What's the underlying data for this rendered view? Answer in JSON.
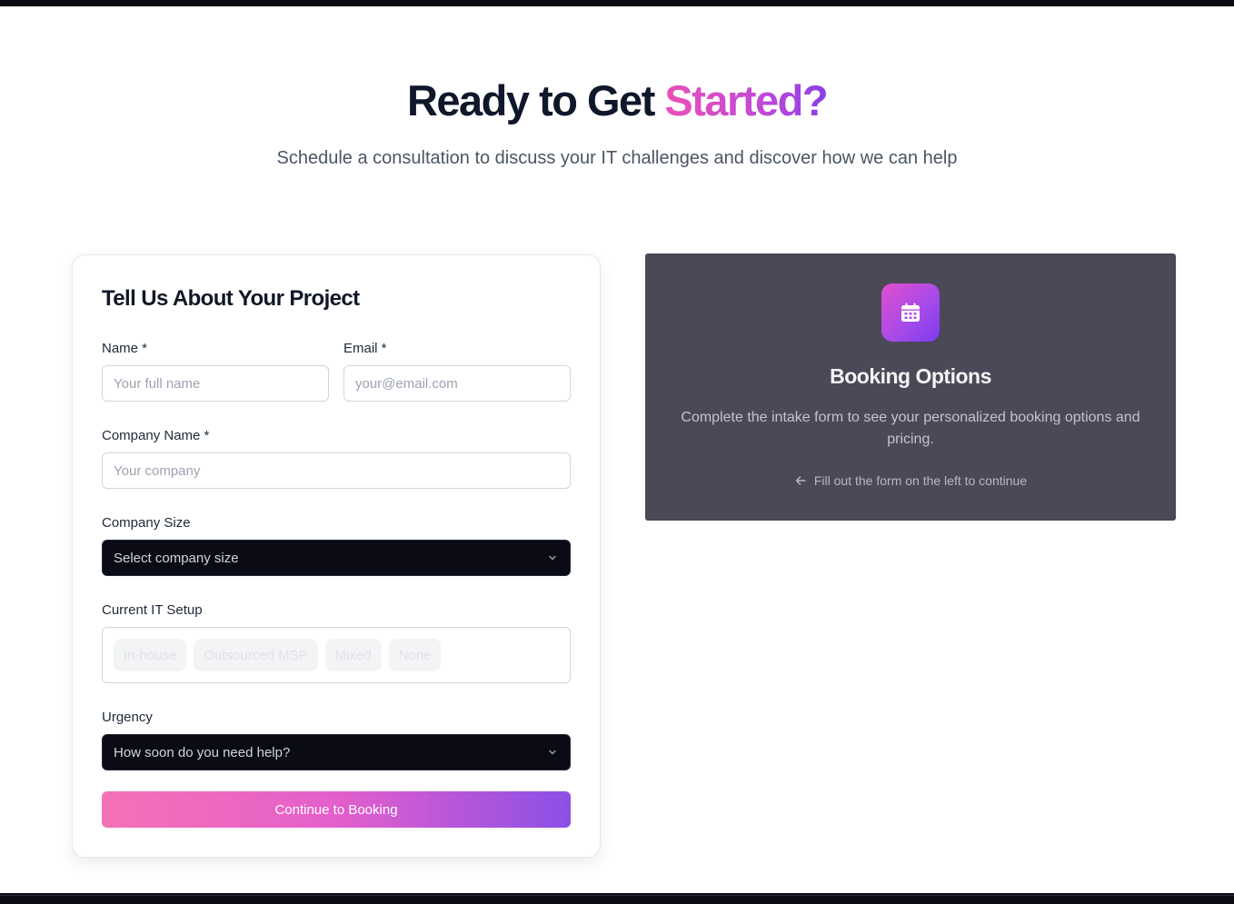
{
  "hero": {
    "title_main": "Ready to Get ",
    "title_accent": "Started?",
    "subtitle": "Schedule a consultation to discuss your IT challenges and discover how we can help"
  },
  "form": {
    "title": "Tell Us About Your Project",
    "name": {
      "label": "Name *",
      "placeholder": "Your full name",
      "value": ""
    },
    "email": {
      "label": "Email *",
      "placeholder": "your@email.com",
      "value": ""
    },
    "company": {
      "label": "Company Name *",
      "placeholder": "Your company",
      "value": ""
    },
    "company_size": {
      "label": "Company Size",
      "selected": "Select company size"
    },
    "it_setup": {
      "label": "Current IT Setup",
      "options": [
        "In-house",
        "Outsourced MSP",
        "Mixed",
        "None"
      ]
    },
    "urgency": {
      "label": "Urgency",
      "selected": "How soon do you need help?"
    },
    "submit_label": "Continue to Booking"
  },
  "booking": {
    "icon": "calendar-icon",
    "title": "Booking Options",
    "description": "Complete the intake form to see your personalized booking options and pricing.",
    "hint": "Fill out the form on the left to continue",
    "hint_icon": "arrow-left-icon"
  },
  "colors": {
    "accent_pink": "#ec4fb8",
    "accent_purple": "#8b3ee8",
    "panel_bg": "#4b4858",
    "select_bg": "#0b0b16"
  }
}
